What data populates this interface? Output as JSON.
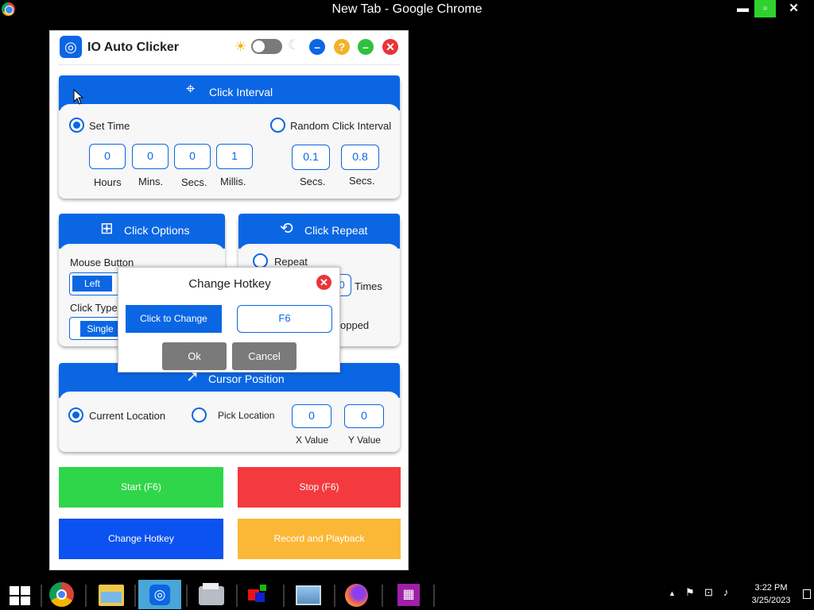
{
  "browser": {
    "title": "New Tab - Google Chrome",
    "min": "▬",
    "close": "✕"
  },
  "app": {
    "title": "IO Auto Clicker",
    "click_interval": {
      "header": "Click Interval",
      "set_time_label": "Set Time",
      "random_label": "Random Click Interval",
      "fields": [
        {
          "value": "0",
          "label": "Hours"
        },
        {
          "value": "0",
          "label": "Mins."
        },
        {
          "value": "0",
          "label": "Secs."
        },
        {
          "value": "1",
          "label": "Millis."
        }
      ],
      "random_fields": [
        {
          "value": "0.1",
          "label": "Secs."
        },
        {
          "value": "0.8",
          "label": "Secs."
        }
      ]
    },
    "click_options": {
      "header": "Click Options",
      "mouse_button_label": "Mouse Button",
      "mouse_button_value": "Left",
      "click_type_label": "Click Type",
      "click_type_value": "Single"
    },
    "click_repeat": {
      "header": "Click Repeat",
      "repeat_label": "Repeat",
      "repeat_value": "10",
      "times_label": "Times",
      "stopped_partial": "opped"
    },
    "cursor_position": {
      "header": "Cursor Position",
      "current_label": "Current Location",
      "pick_label": "Pick Location",
      "x_value": "0",
      "y_value": "0",
      "x_label": "X Value",
      "y_label": "Y Value"
    },
    "buttons": {
      "start": "Start (F6)",
      "stop": "Stop (F6)",
      "change_hotkey": "Change Hotkey",
      "record": "Record and Playback"
    }
  },
  "dialog": {
    "title": "Change Hotkey",
    "change_button": "Click to Change",
    "hotkey_value": "F6",
    "ok": "Ok",
    "cancel": "Cancel"
  },
  "taskbar": {
    "time": "3:22 PM",
    "date": "3/25/2023"
  },
  "colors": {
    "accent": "#0b66e4",
    "start": "#2fd64a",
    "stop": "#f4393f",
    "record": "#fbb836",
    "neutral": "#7a7a7a"
  }
}
